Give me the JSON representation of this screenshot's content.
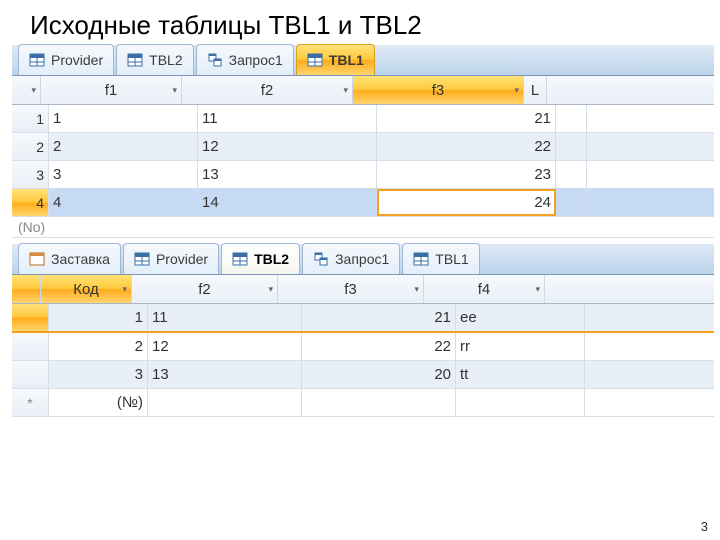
{
  "slide": {
    "title": "Исходные таблицы TBL1 и TBL2",
    "page_number": "3"
  },
  "tbl1": {
    "tabs": [
      {
        "label": "Provider",
        "icon": "table",
        "active": false
      },
      {
        "label": "TBL2",
        "icon": "table",
        "active": false
      },
      {
        "label": "Запрос1",
        "icon": "query",
        "active": false
      },
      {
        "label": "TBL1",
        "icon": "table",
        "active": true
      }
    ],
    "columns": [
      "f1",
      "f2",
      "f3"
    ],
    "last_column_fragment": "L",
    "rows": [
      {
        "n": "1",
        "f1": "1",
        "f2": "11",
        "f3": "21"
      },
      {
        "n": "2",
        "f1": "2",
        "f2": "12",
        "f3": "22"
      },
      {
        "n": "3",
        "f1": "3",
        "f2": "13",
        "f3": "23"
      },
      {
        "n": "4",
        "f1": "4",
        "f2": "14",
        "f3": "24"
      }
    ],
    "new_row_marker": "(No)"
  },
  "tbl2": {
    "tabs": [
      {
        "label": "Заставка",
        "icon": "form",
        "active": false
      },
      {
        "label": "Provider",
        "icon": "table",
        "active": false
      },
      {
        "label": "TBL2",
        "icon": "table",
        "active": true
      },
      {
        "label": "Запрос1",
        "icon": "query",
        "active": false
      },
      {
        "label": "TBL1",
        "icon": "table",
        "active": false
      }
    ],
    "columns": [
      "Код",
      "f2",
      "f3",
      "f4"
    ],
    "rows": [
      {
        "kod": "1",
        "f2": "11",
        "f3": "21",
        "f4": "ee"
      },
      {
        "kod": "2",
        "f2": "12",
        "f3": "22",
        "f4": "rr"
      },
      {
        "kod": "3",
        "f2": "13",
        "f3": "20",
        "f4": "tt"
      }
    ],
    "new_row_marker": "(№)"
  }
}
